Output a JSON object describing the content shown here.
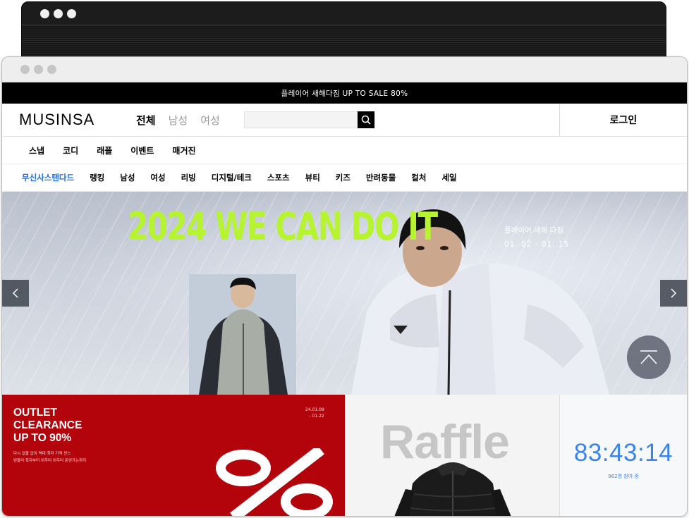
{
  "promo": {
    "text": "플레이어 새해다짐 UP TO SALE 80%"
  },
  "header": {
    "logo": "MUSINSA",
    "gender_tabs": [
      "전체",
      "남성",
      "여성"
    ],
    "login_label": "로그인"
  },
  "search": {
    "placeholder": ""
  },
  "subnav": {
    "items": [
      "스냅",
      "코디",
      "래플",
      "이벤트",
      "매거진"
    ]
  },
  "category_nav": {
    "items": [
      "무신사스탠다드",
      "랭킹",
      "남성",
      "여성",
      "리빙",
      "디지털/테크",
      "스포츠",
      "뷰티",
      "키즈",
      "반려동물",
      "컬처",
      "세일"
    ]
  },
  "hero": {
    "title": "2024 WE CAN DO IT",
    "event_name": "플레이어 새해 다짐",
    "event_dates": "01. 02 - 01. 15"
  },
  "outlet": {
    "title": "OUTLET\nCLEARANCE\nUP TO 90%",
    "description": "다시 없을 없이 역대 최저 가격 찬스\n믿을리 폭자부터 이우터 이우터 준얻가는까지",
    "date": "24.01.09\n- 01.22"
  },
  "raffle": {
    "title": "Raffle"
  },
  "countdown": {
    "time": "83:43:14",
    "participants": "962명 참여 중"
  },
  "colors": {
    "hero_title": "#b7f430",
    "outlet_bg": "#b3040b",
    "countdown_blue": "#3d84e8",
    "nav_highlight": "#1e6fe0"
  }
}
